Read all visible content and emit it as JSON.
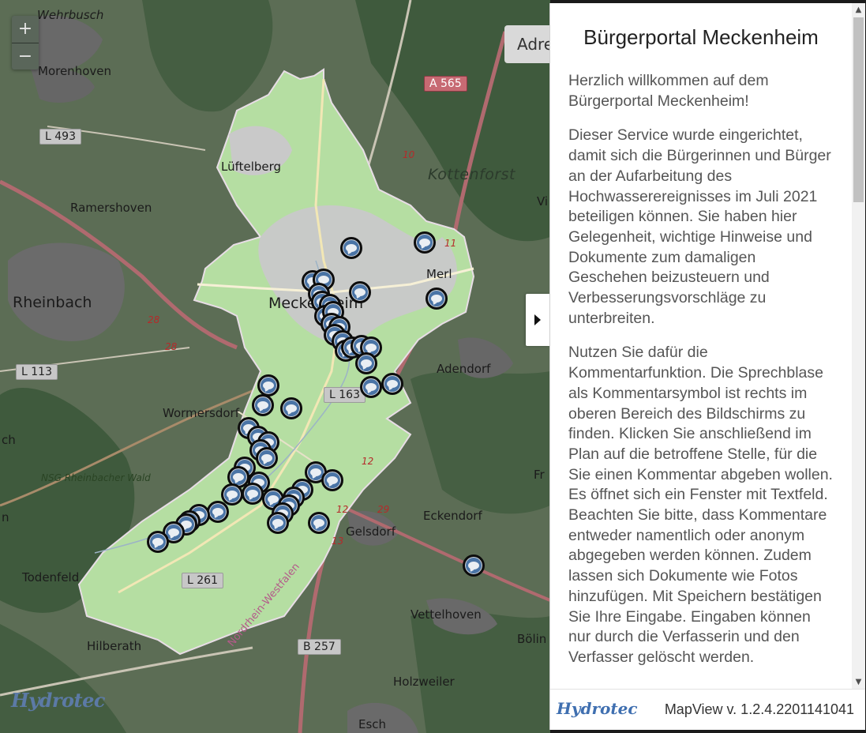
{
  "map": {
    "zoom_in": "+",
    "zoom_out": "−",
    "address_placeholder": "Adre",
    "places": {
      "wehrbusch": "Wehrbusch",
      "morenhoven": "Morenhoven",
      "lueftelberg": "Lüftelberg",
      "ramershoven": "Ramershoven",
      "rheinbach": "Rheinbach",
      "meckenheim": "Meckenheim",
      "merl": "Merl",
      "kottenforst": "Kottenforst",
      "adendorf": "Adendorf",
      "wormersdorf": "Wormersdorf",
      "nsg": "NSG Rheinbacher Wald",
      "eckendorf": "Eckendorf",
      "gelsdorf": "Gelsdorf",
      "todenfeld": "Todenfeld",
      "vettelhoven": "Vettelhoven",
      "hilberath": "Hilberath",
      "holzweiler": "Holzweiler",
      "esch": "Esch",
      "boelin": "Bölin",
      "nrw": "Nordrhein-Westfalen",
      "ch": "ch",
      "n": "n",
      "fr": "Fr",
      "vi": "Vi"
    },
    "roads": {
      "a565": "A 565",
      "l493": "L 493",
      "l113": "L 113",
      "l163": "L 163",
      "l261": "L 261",
      "b257": "B 257"
    },
    "km_marks": [
      "10",
      "11",
      "28",
      "28",
      "12",
      "12",
      "13",
      "29"
    ],
    "logo": "Hydrotec",
    "marker_count": 54
  },
  "panel": {
    "title": "Bürgerportal Meckenheim",
    "paragraphs": [
      "Herzlich willkommen auf dem Bürgerportal Meckenheim!",
      "Dieser Service wurde eingerichtet, damit sich die Bürgerinnen und Bürger an der Aufarbeitung des Hochwasserereignisses im Juli 2021 beteiligen können. Sie haben hier Gelegenheit, wichtige Hinweise und Dokumente zum damaligen Geschehen beizusteuern und Verbesserungsvorschläge zu unterbreiten.",
      "Nutzen Sie dafür die Kommentarfunktion. Die Sprechblase als Kommentarsymbol ist rechts im oberen Bereich des Bildschirms zu finden. Klicken Sie anschließend im Plan auf die betroffene Stelle, für die Sie einen Kommentar abgeben wollen. Es öffnet sich ein Fenster mit Textfeld. Beachten Sie bitte, dass Kommentare entweder namentlich oder anonym abgegeben werden können. Zudem lassen sich Dokumente wie Fotos hinzufügen. Mit Speichern bestätigen Sie Ihre Eingabe. Eingaben können nur durch die Verfasserin und den Verfasser gelöscht werden."
    ],
    "footer_logo": "Hydrotec",
    "version": "MapView v. 1.2.4.2201141041"
  },
  "icons": {
    "marker": "comment-bubble-icon",
    "toggle": "caret-right-icon",
    "scroll_up": "scroll-up-arrow-icon",
    "scroll_down": "scroll-down-arrow-icon"
  },
  "colors": {
    "marker_fill": "#4a74a6",
    "marker_border": "#0d0d0d",
    "area_fill": "#b5dea2",
    "map_dim": "#4f6048",
    "brand": "#3f6fb0"
  }
}
